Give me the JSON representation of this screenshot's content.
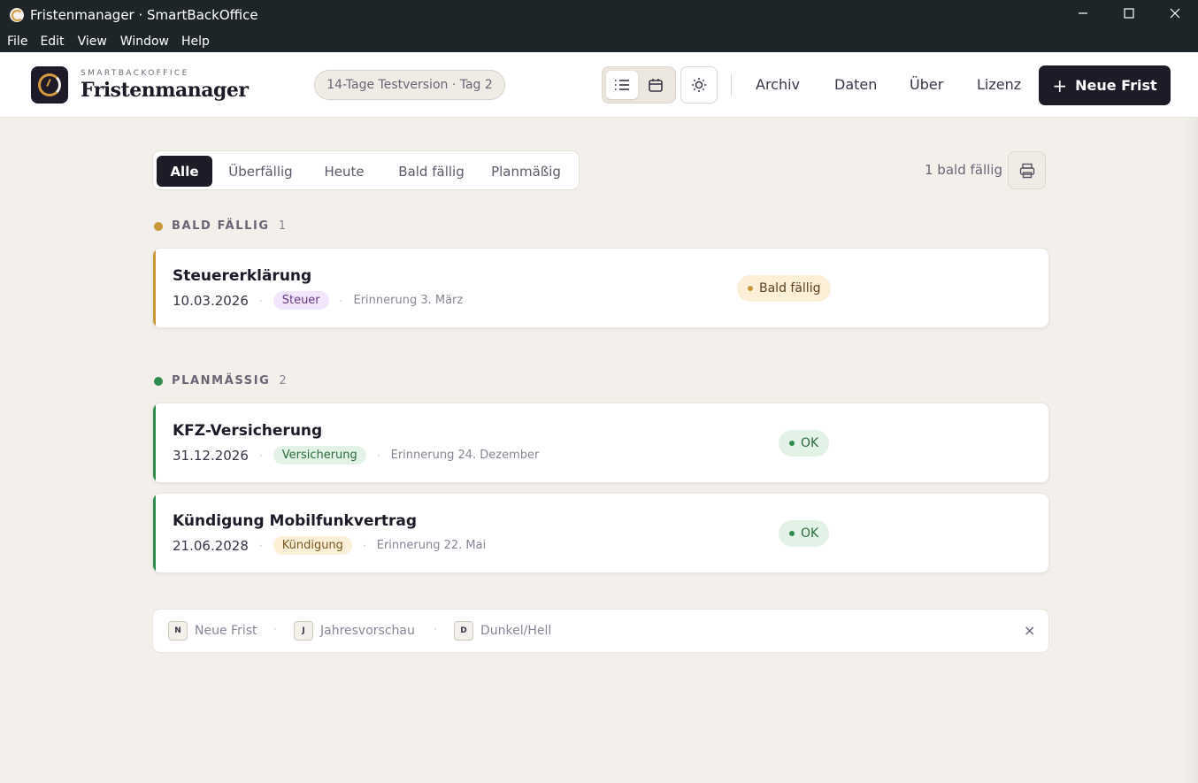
{
  "window": {
    "title": "Fristenmanager · SmartBackOffice",
    "controls": [
      "minimize-icon",
      "maximize-icon",
      "close-icon"
    ]
  },
  "menu": [
    "File",
    "Edit",
    "View",
    "Window",
    "Help"
  ],
  "header": {
    "brand_small": "SMARTBACKOFFICE",
    "brand_big": "Fristenmanager",
    "trial": "14-Tage Testversion · Tag 2",
    "nav": [
      "Archiv",
      "Daten",
      "Über",
      "Lizenz"
    ],
    "new_button": "Neue Frist",
    "new_button_icon": "+"
  },
  "filters": {
    "tabs": [
      "Alle",
      "Überfällig",
      "Heute",
      "Bald fällig",
      "Planmäßig"
    ],
    "active": "Alle",
    "count_text": "1 bald fällig"
  },
  "sections": [
    {
      "title": "BALD FÄLLIG",
      "count": "1",
      "color": "#c9973a",
      "items": [
        {
          "title": "Steuererklärung",
          "date": "10.03.2026",
          "tag": "Steuer",
          "tag_bg": "#f1e6fb",
          "tag_color": "#6b3a8a",
          "reminder": "Erinnerung 3. März",
          "status": "Bald fällig",
          "status_bg": "#fcefd8",
          "status_color": "#5a4320",
          "status_dot": "#c9973a",
          "accent": "#c9973a"
        }
      ]
    },
    {
      "title": "PLANMÄSSIG",
      "count": "2",
      "color": "#2e8b4e",
      "items": [
        {
          "title": "KFZ-Versicherung",
          "date": "31.12.2026",
          "tag": "Versicherung",
          "tag_bg": "#e3f2e6",
          "tag_color": "#2a6a3a",
          "reminder": "Erinnerung 24. Dezember",
          "status": "OK",
          "status_bg": "#e3f2e6",
          "status_color": "#2a6a3a",
          "status_dot": "#2e8b4e",
          "accent": "#2e8b4e"
        },
        {
          "title": "Kündigung Mobilfunkvertrag",
          "date": "21.06.2028",
          "tag": "Kündigung",
          "tag_bg": "#fcefd8",
          "tag_color": "#7a5a20",
          "reminder": "Erinnerung 22. Mai",
          "status": "OK",
          "status_bg": "#e3f2e6",
          "status_color": "#2a6a3a",
          "status_dot": "#2e8b4e",
          "accent": "#2e8b4e"
        }
      ]
    }
  ],
  "shortcuts": [
    {
      "key": "N",
      "label": "Neue Frist"
    },
    {
      "key": "J",
      "label": "Jahresvorschau"
    },
    {
      "key": "D",
      "label": "Dunkel/Hell"
    }
  ],
  "shortcuts_close": "×"
}
